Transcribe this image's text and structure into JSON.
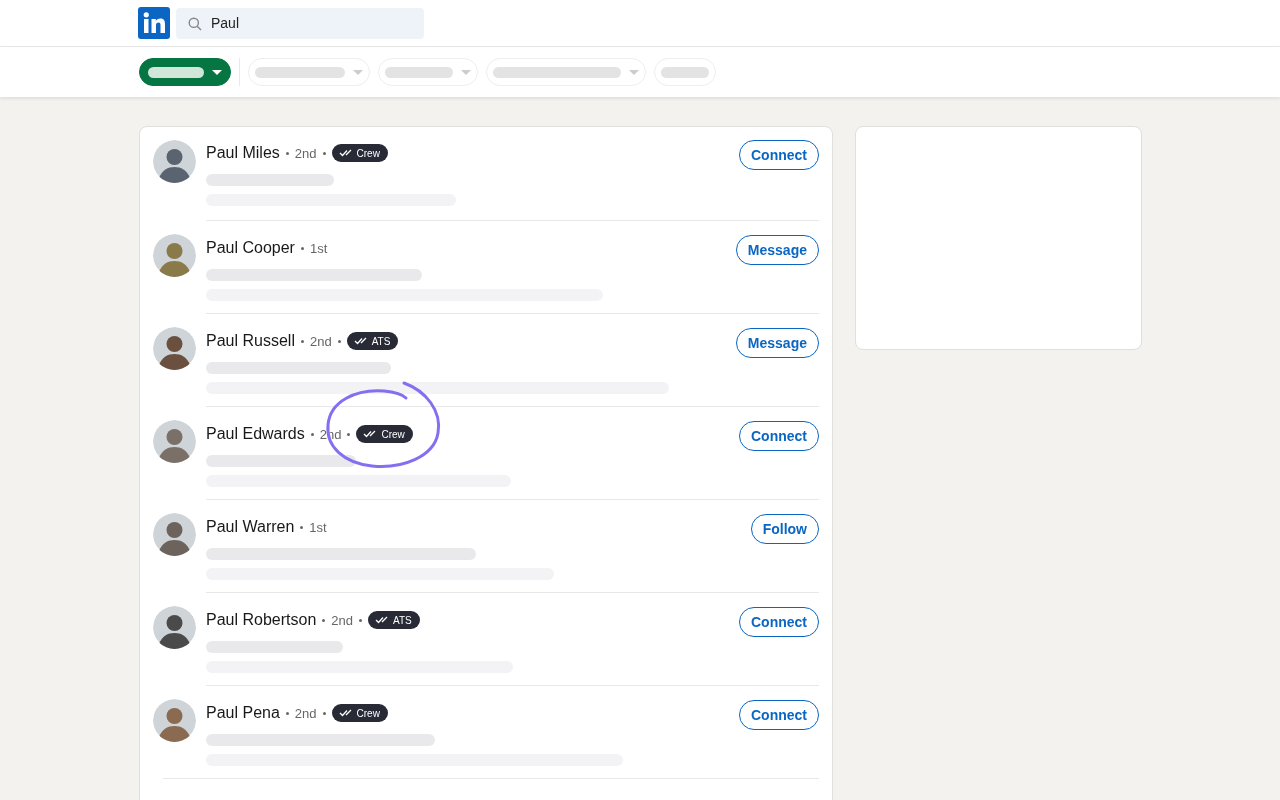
{
  "search": {
    "value": "Paul"
  },
  "filters": [
    {
      "selected": true
    },
    {
      "selected": false
    },
    {
      "selected": false
    },
    {
      "selected": false
    },
    {
      "selected": false
    }
  ],
  "people": [
    {
      "name": "Paul Miles",
      "degree": "2nd",
      "badge": "Crew",
      "action": "Connect",
      "highlighted": false
    },
    {
      "name": "Paul Cooper",
      "degree": "1st",
      "action": "Message",
      "highlighted": false
    },
    {
      "name": "Paul Russell",
      "degree": "2nd",
      "badge": "ATS",
      "action": "Message",
      "highlighted": false
    },
    {
      "name": "Paul Edwards",
      "degree": "2nd",
      "badge": "Crew",
      "action": "Connect",
      "highlighted": true
    },
    {
      "name": "Paul Warren",
      "degree": "1st",
      "action": "Follow",
      "highlighted": false
    },
    {
      "name": "Paul Robertson",
      "degree": "2nd",
      "badge": "ATS",
      "action": "Connect",
      "highlighted": false
    },
    {
      "name": "Paul Pena",
      "degree": "2nd",
      "badge": "Crew",
      "action": "Connect",
      "highlighted": false
    }
  ]
}
